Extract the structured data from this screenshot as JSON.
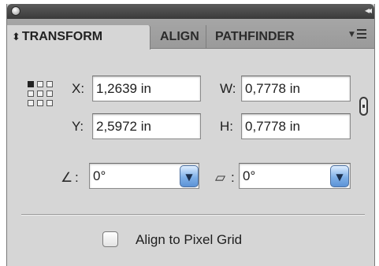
{
  "panel": {
    "collapse_symbol": "◂◂",
    "tabs": [
      {
        "label": "TRANSFORM",
        "prefix": "⬍",
        "active": true
      },
      {
        "label": "ALIGN",
        "active": false
      },
      {
        "label": "PATHFINDER",
        "active": false
      }
    ]
  },
  "transform": {
    "x_label": "X:",
    "x_value": "1,2639 in",
    "y_label": "Y:",
    "y_value": "2,5972 in",
    "w_label": "W:",
    "w_value": "0,7778 in",
    "h_label": "H:",
    "h_value": "0,7778 in",
    "rotate_label": ":",
    "rotate_value": "0°",
    "shear_label": ":",
    "shear_value": "0°",
    "combo_arrow": "▼"
  },
  "options": {
    "align_pixel_grid_label": "Align to Pixel Grid",
    "align_pixel_grid_checked": false
  },
  "icons": {
    "close": "close-icon",
    "collapse": "collapse-arrows-icon",
    "menu": "panel-menu-icon",
    "reference_point": "reference-point-icon",
    "link": "constrain-proportions-link-icon",
    "rotate": "rotate-angle-icon",
    "shear": "shear-icon"
  },
  "colors": {
    "panel_bg": "#d6d6d6",
    "titlebar": "#4a4a4a",
    "combo_button": "#7fb0e8"
  }
}
